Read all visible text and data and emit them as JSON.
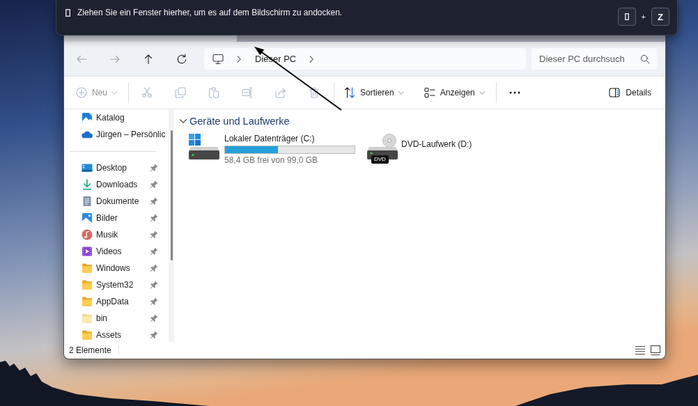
{
  "snap_hint": {
    "text": "Ziehen Sie ein Fenster hierher, um es auf dem Bildschirm zu andocken.",
    "keys": [
      {
        "kind": "glyph"
      },
      {
        "kind": "letter",
        "label": "Z"
      }
    ],
    "joiner": "+"
  },
  "explorer": {
    "navigation": [
      {
        "kind": "back",
        "disabled": true
      },
      {
        "kind": "forward",
        "disabled": true
      },
      {
        "kind": "up",
        "disabled": false
      },
      {
        "kind": "refresh",
        "disabled": false
      }
    ],
    "address_bar": {
      "path": [
        "Dieser PC"
      ]
    },
    "search": {
      "placeholder": "Dieser PC durchsuch"
    },
    "command_bar": {
      "groups": [
        [
          {
            "kind": "new",
            "label": "Neu",
            "disabled": true,
            "dropdown": true
          }
        ],
        [
          {
            "kind": "cut",
            "disabled": true,
            "dropdown": false
          },
          {
            "kind": "copy",
            "disabled": true,
            "dropdown": false
          },
          {
            "kind": "paste",
            "disabled": true,
            "dropdown": false
          },
          {
            "kind": "rename",
            "disabled": true,
            "dropdown": false
          },
          {
            "kind": "share",
            "disabled": true,
            "dropdown": false
          },
          {
            "kind": "delete",
            "disabled": true,
            "dropdown": false
          }
        ],
        [
          {
            "kind": "sort",
            "label": "Sortieren",
            "disabled": false,
            "dropdown": true
          },
          {
            "kind": "view",
            "label": "Anzeigen",
            "disabled": false,
            "dropdown": true
          }
        ],
        [
          {
            "kind": "more",
            "disabled": false,
            "dropdown": false
          }
        ]
      ],
      "details": {
        "label": "Details"
      }
    },
    "sidebar": {
      "sections": [
        {
          "items": [
            {
              "kind": "gallery",
              "label": "Katalog",
              "pinned": false,
              "hidden": false
            },
            {
              "kind": "onedrive",
              "label": "Jürgen – Persönlic",
              "pinned": false,
              "hidden": false
            }
          ]
        },
        {
          "items": [
            {
              "kind": "desktop",
              "label": "Desktop",
              "pinned": true,
              "hidden": false
            },
            {
              "kind": "downloads",
              "label": "Downloads",
              "pinned": true,
              "hidden": false
            },
            {
              "kind": "documents",
              "label": "Dokumente",
              "pinned": true,
              "hidden": false
            },
            {
              "kind": "pictures",
              "label": "Bilder",
              "pinned": true,
              "hidden": false
            },
            {
              "kind": "music",
              "label": "Musik",
              "pinned": true,
              "hidden": false
            },
            {
              "kind": "videos",
              "label": "Videos",
              "pinned": true,
              "hidden": false
            },
            {
              "kind": "folder",
              "label": "Windows",
              "pinned": true,
              "hidden": false
            },
            {
              "kind": "folder",
              "label": "System32",
              "pinned": true,
              "hidden": false
            },
            {
              "kind": "folder",
              "label": "AppData",
              "pinned": true,
              "hidden": false
            },
            {
              "kind": "folder",
              "label": "bin",
              "pinned": true,
              "hidden": true
            },
            {
              "kind": "folder",
              "label": "Assets",
              "pinned": true,
              "hidden": false
            }
          ]
        }
      ]
    },
    "content": {
      "groups": [
        {
          "title": "Geräte und Laufwerke",
          "expanded": true,
          "drives": [
            {
              "kind": "system",
              "name": "Lokaler Datenträger (C:)",
              "level": 0.41,
              "capacity": "58,4 GB frei von 99,0 GB"
            },
            {
              "kind": "dvd",
              "name": "DVD-Laufwerk (D:)",
              "badge": "DVD"
            }
          ]
        }
      ]
    },
    "status_bar": {
      "count": "2 Elemente",
      "views": [
        {
          "kind": "list"
        },
        {
          "kind": "tiles"
        }
      ]
    }
  }
}
